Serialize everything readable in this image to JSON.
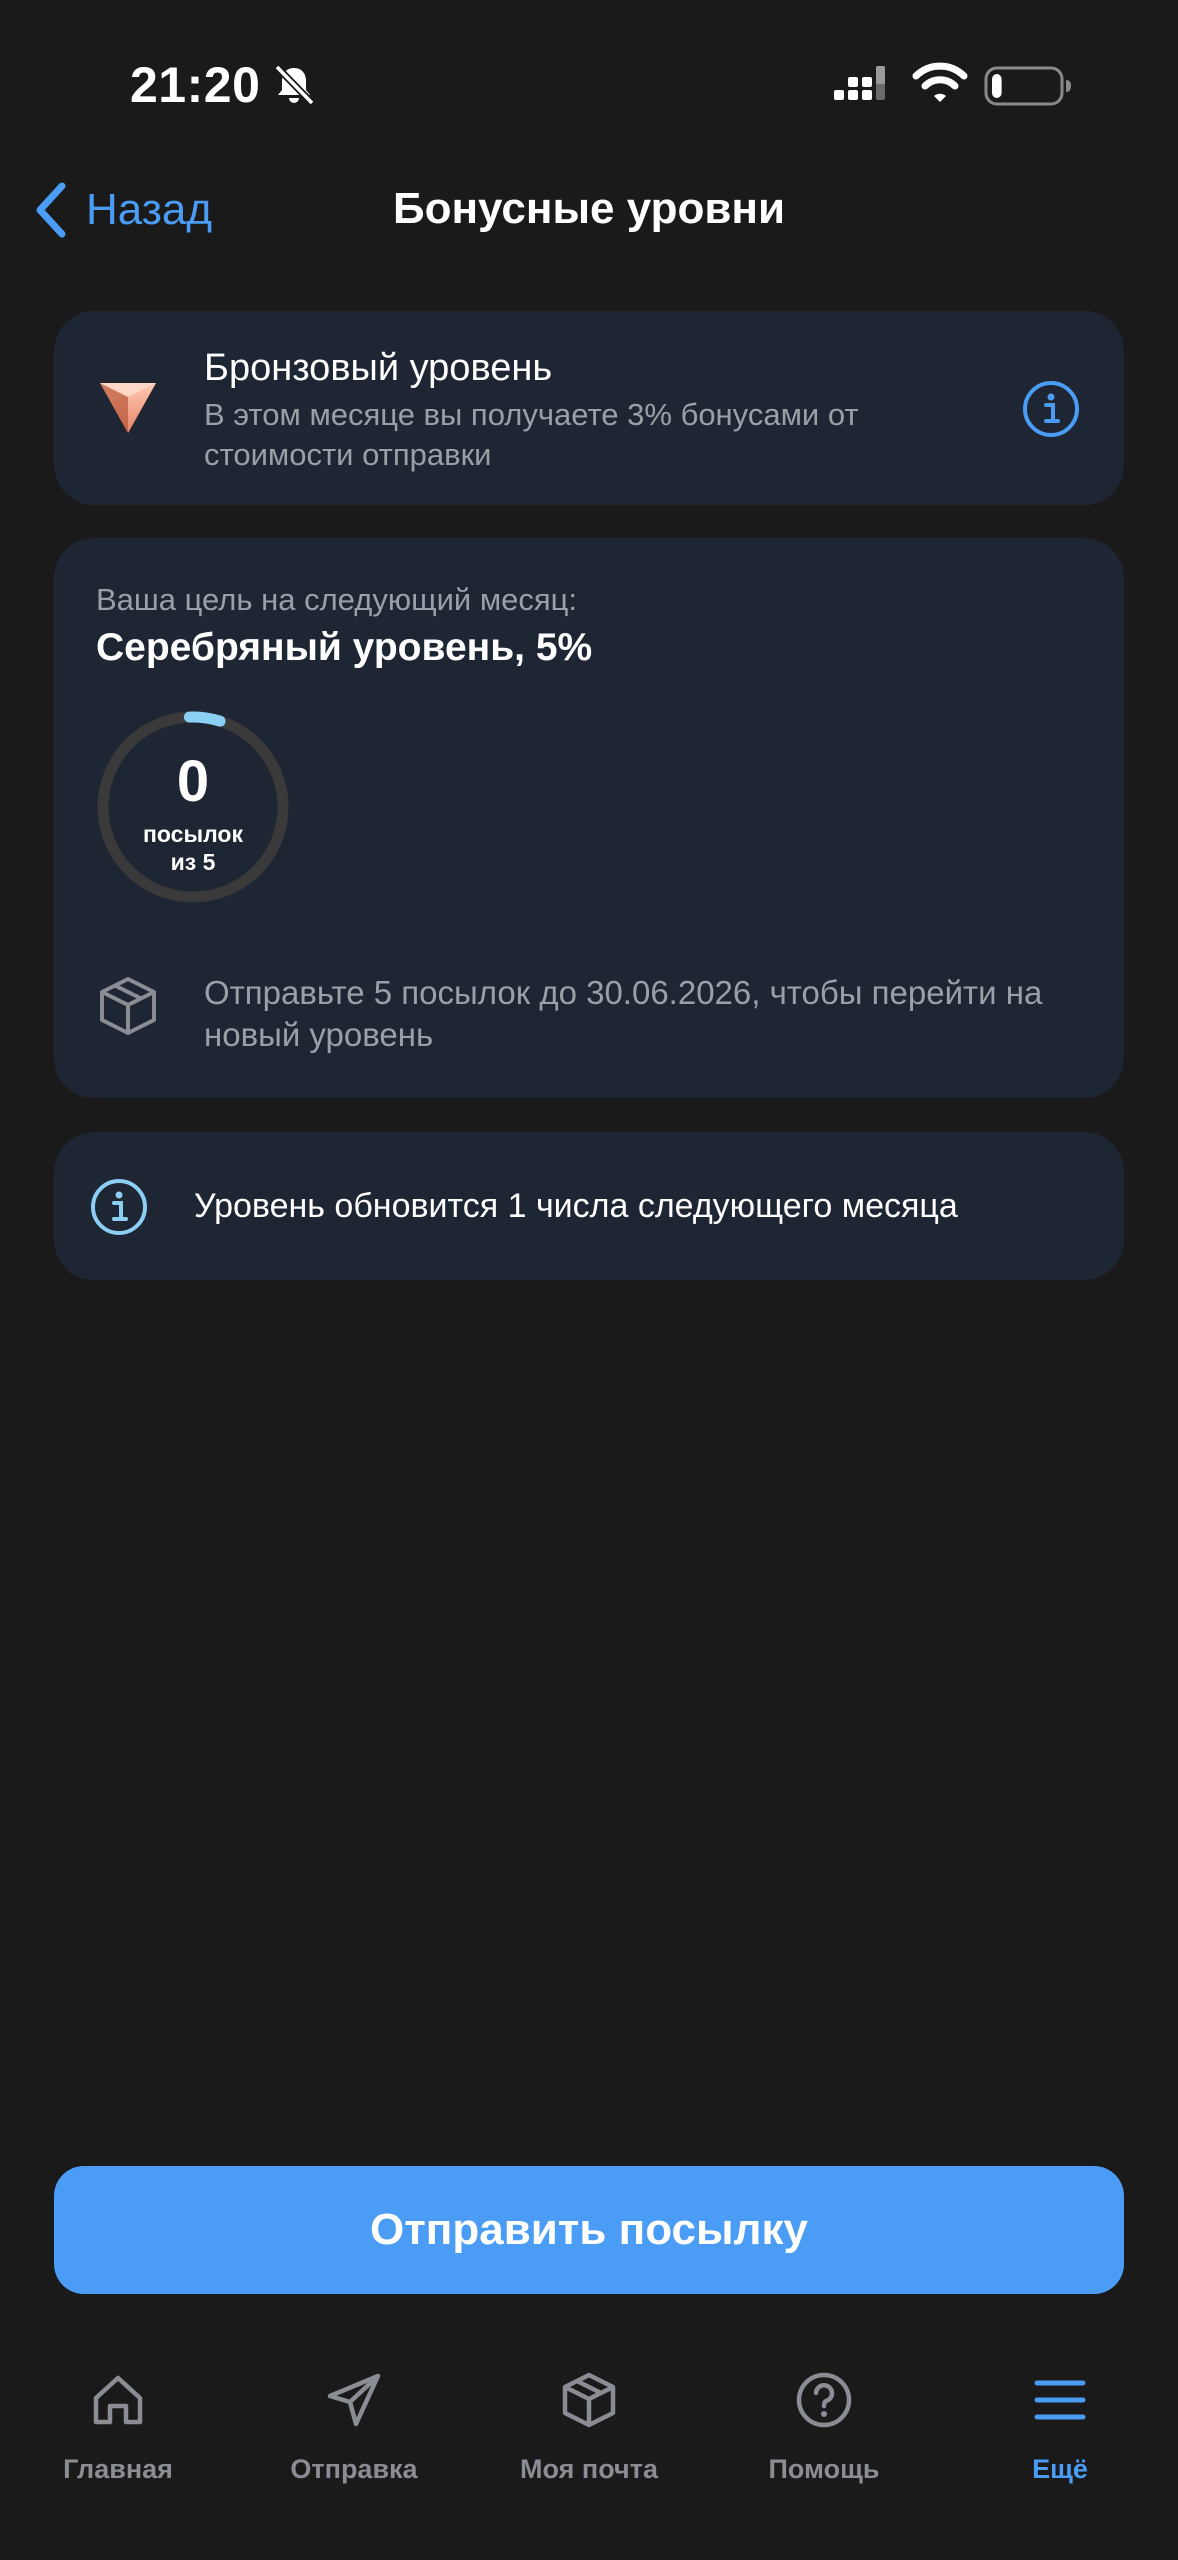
{
  "status_bar": {
    "time": "21:20",
    "icons": [
      "bell-slash-icon",
      "cellular-signal-icon",
      "wifi-icon",
      "battery-icon"
    ],
    "battery_level": 0.15
  },
  "nav": {
    "back_label": "Назад",
    "title": "Бонусные уровни"
  },
  "current_tier": {
    "name": "Бронзовый уровень",
    "description": "В этом месяце вы получаете 3% бонусами от стоимости отправки",
    "badge_color": "#e8866a"
  },
  "goal": {
    "label": "Ваша цель на следующий месяц:",
    "value": "Серебряный уровень, 5%",
    "progress": {
      "count": "0",
      "unit": "посылок",
      "total": "из 5",
      "fraction": 0
    },
    "hint": "Отправьте 5 посылок до 30.06.2026, чтобы перейти на новый уровень"
  },
  "info": {
    "text": "Уровень обновится 1 числа следующего месяца"
  },
  "primary_action": {
    "label": "Отправить посылку"
  },
  "tab_bar": {
    "items": [
      {
        "label": "Главная",
        "icon": "home-icon",
        "active": false
      },
      {
        "label": "Отправка",
        "icon": "paper-plane-icon",
        "active": false
      },
      {
        "label": "Моя почта",
        "icon": "package-icon",
        "active": false
      },
      {
        "label": "Помощь",
        "icon": "help-circle-icon",
        "active": false
      },
      {
        "label": "Ещё",
        "icon": "menu-icon",
        "active": true
      }
    ]
  },
  "colors": {
    "background": "#1a1a1a",
    "card": "#1e2633",
    "accent": "#4a9cf5",
    "secondary_text": "#9aa0a8",
    "ring_track": "#3a3a3a",
    "ring_progress": "#8ccff5"
  }
}
